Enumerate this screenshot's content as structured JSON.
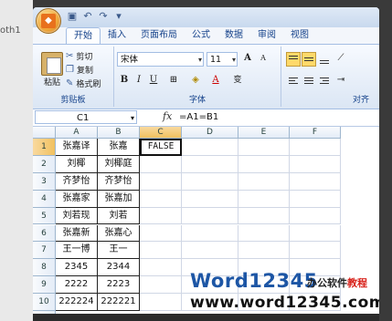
{
  "left_fragment": "oth1",
  "quick_access": [
    "save-icon",
    "undo-icon",
    "redo-icon",
    "customize-icon"
  ],
  "tabs": [
    "开始",
    "插入",
    "页面布局",
    "公式",
    "数据",
    "审阅",
    "视图"
  ],
  "clipboard": {
    "paste": "粘贴",
    "cut": "剪切",
    "copy": "复制",
    "format_painter": "格式刷",
    "group_label": "剪贴板"
  },
  "font": {
    "name": "宋体",
    "size": "11",
    "bold": "B",
    "italic": "I",
    "underline": "U",
    "grow": "A",
    "shrink": "A",
    "phonetic": "变",
    "color_a": "A",
    "group_label": "字体"
  },
  "alignment": {
    "group_label": "对齐"
  },
  "formula_bar": {
    "name_box": "C1",
    "fx": "fx",
    "formula": "=A1=B1"
  },
  "columns": [
    "A",
    "B",
    "C",
    "D",
    "E",
    "F"
  ],
  "rows": [
    {
      "num": "1",
      "a": "张嘉译",
      "b": "张嘉",
      "c": "FALSE"
    },
    {
      "num": "2",
      "a": "刘椰",
      "b": "刘椰庭",
      "c": ""
    },
    {
      "num": "3",
      "a": "齐梦怡",
      "b": "齐梦怡",
      "c": ""
    },
    {
      "num": "4",
      "a": "张嘉家",
      "b": "张嘉加",
      "c": ""
    },
    {
      "num": "5",
      "a": "刘若现",
      "b": "刘若",
      "c": ""
    },
    {
      "num": "6",
      "a": "张嘉新",
      "b": "张嘉心",
      "c": ""
    },
    {
      "num": "7",
      "a": "王一博",
      "b": "王一",
      "c": ""
    },
    {
      "num": "8",
      "a": "2345",
      "b": "2344",
      "c": ""
    },
    {
      "num": "9",
      "a": "2222",
      "b": "2223",
      "c": ""
    },
    {
      "num": "10",
      "a": "222224",
      "b": "222221",
      "c": ""
    }
  ],
  "watermark": {
    "w": "W",
    "rest": "ord12345",
    "cn": "办公软件",
    "cn_red": "教程",
    "url": "www.word12345.com"
  },
  "colors": {
    "accent": "#15428b",
    "selected_header": "#f1c15f",
    "watermark_blue": "#1d56a5",
    "watermark_red": "#d8231c"
  }
}
